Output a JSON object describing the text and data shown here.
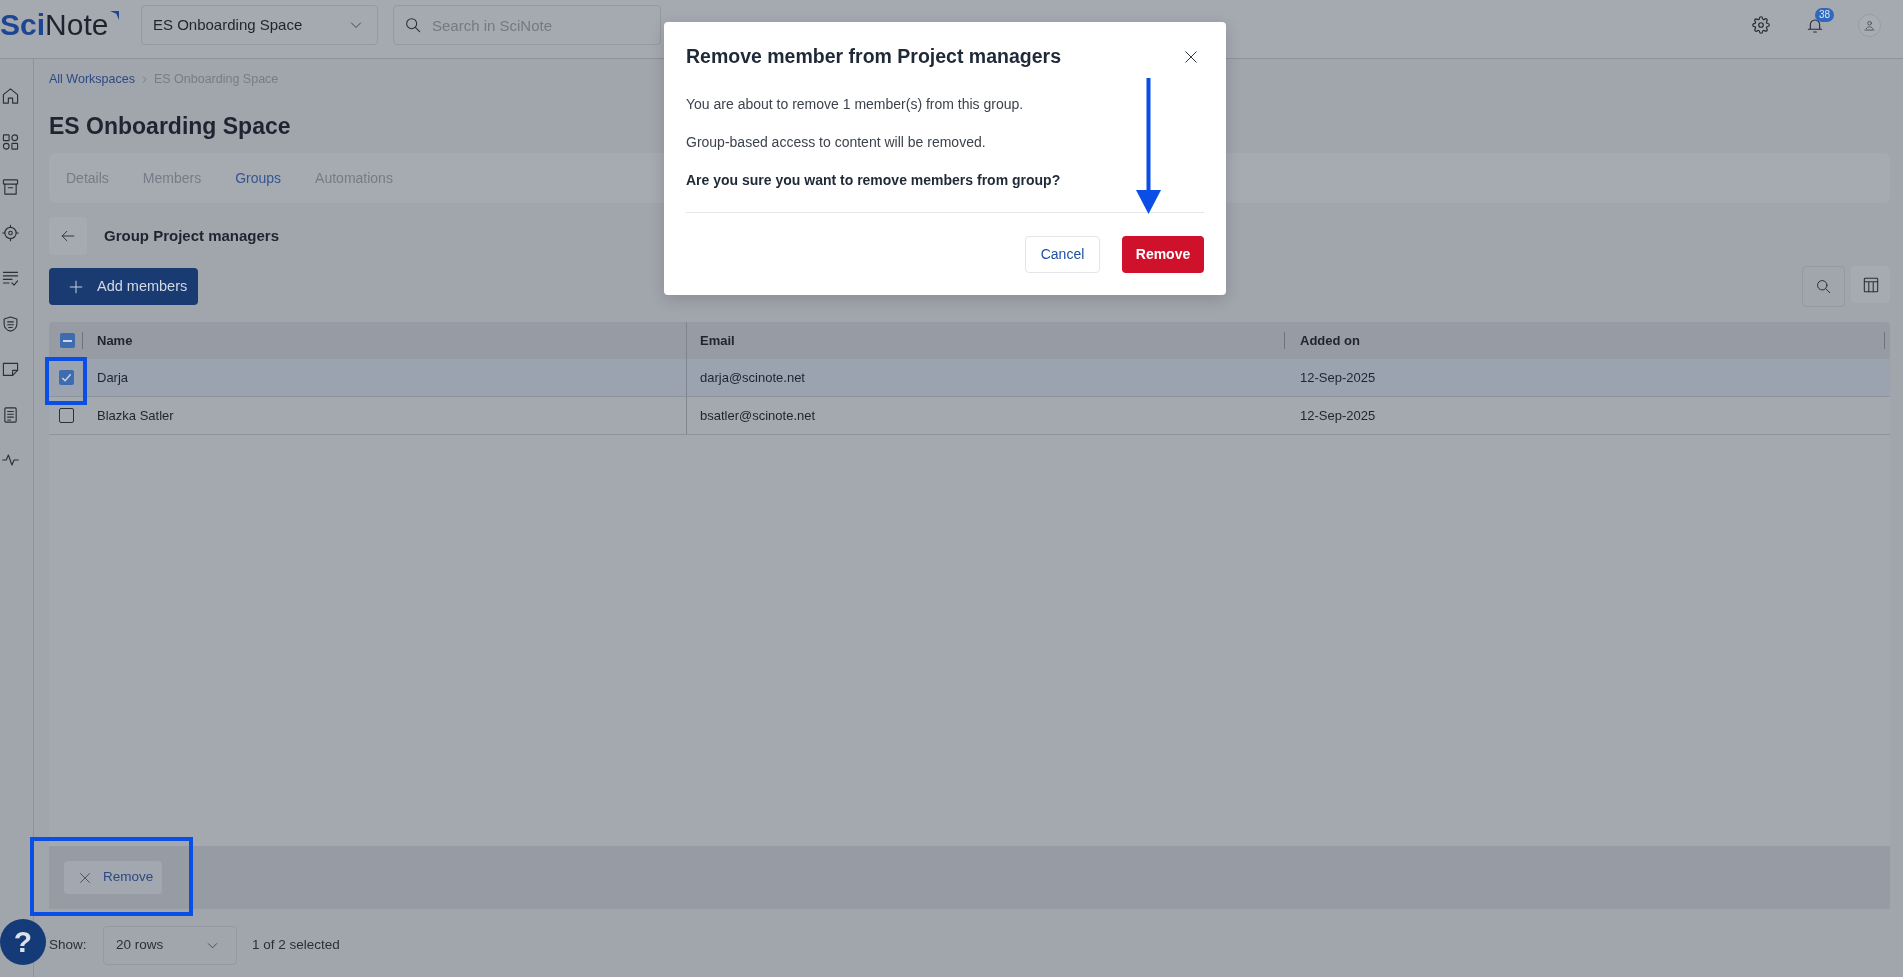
{
  "top_bar": {
    "logo": "**Sci**Note",
    "workspace_select": {
      "value": "ES Onboarding Space"
    },
    "search": {
      "placeholder": "Search in SciNote"
    },
    "notifications": {
      "badge": "38"
    }
  },
  "breadcrumb": [
    {
      "label": "All Workspaces",
      "kind": "link"
    },
    {
      "label": "ES Onboarding Space",
      "kind": "current"
    }
  ],
  "page_title": "ES Onboarding Space",
  "tabs": [
    {
      "label": "Details",
      "selected": false
    },
    {
      "label": "Members",
      "selected": false
    },
    {
      "label": "Groups",
      "selected": true
    },
    {
      "label": "Automations",
      "selected": false
    }
  ],
  "group_title": "Group Project managers",
  "toolbar": {
    "add_button": "Add members"
  },
  "table": {
    "select_all": {
      "indeterminate": true
    },
    "columns": [
      "Name",
      "Email",
      "Added on"
    ],
    "rows": [
      {
        "selected": true,
        "name": "Darja",
        "email": "darja@scinote.net",
        "added_on": "12-Sep-2025"
      },
      {
        "selected": false,
        "name": "Blazka Satler",
        "email": "bsatler@scinote.net",
        "added_on": "12-Sep-2025"
      }
    ]
  },
  "selection_bar": {
    "remove_button": "Remove"
  },
  "footer": {
    "show_label": "Show:",
    "page_size": {
      "value": "20 rows"
    },
    "selection_count": "1 of 2 selected"
  },
  "help_button": {
    "label": "?"
  },
  "dialog": {
    "title": "Remove member from Project managers",
    "paragraphs": [
      {
        "text": "You are about to remove 1 member(s) from this group.",
        "bold": false
      },
      {
        "text": "Group-based access to content will be removed.",
        "bold": false
      },
      {
        "text": "Are you sure you want to remove members from group?",
        "bold": true
      }
    ],
    "buttons": [
      {
        "label": "Cancel",
        "kind": "secondary"
      },
      {
        "label": "Remove",
        "kind": "danger"
      }
    ]
  }
}
